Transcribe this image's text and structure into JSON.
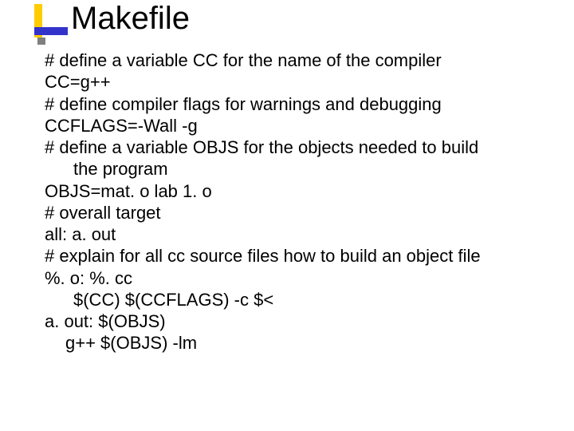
{
  "slide": {
    "title": "Makefile",
    "lines": [
      "# define a variable CC for the name of the compiler",
      "CC=g++",
      "# define compiler flags for warnings and debugging",
      "CCFLAGS=-Wall -g",
      "# define a variable OBJS  for the objects needed to build",
      "the program",
      "OBJS=mat. o lab 1. o",
      "# overall target",
      "all:   a. out",
      "# explain for all cc source files how to build an object file",
      "%. o:   %. cc",
      "$(CC) $(CCFLAGS) -c $<",
      "a. out:  $(OBJS)",
      "g++  $(OBJS)  -lm"
    ]
  }
}
